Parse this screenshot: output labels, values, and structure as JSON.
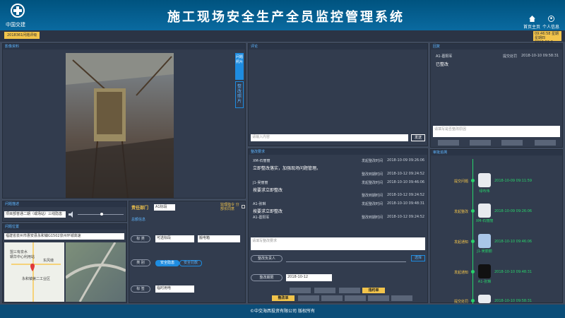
{
  "header": {
    "logo_text": "中国交建",
    "title": "施工现场安全生产全员监控管理系统",
    "home_label": "首页主页",
    "user_label": "个人信息"
  },
  "subbar": {
    "tag": "2018361问题评级",
    "date_line1": "09:46:58 星期星期四",
    "date_line2": "2018-02-6"
  },
  "left": {
    "photo_title": "影像资料",
    "tabs": [
      "问题照片",
      "整改照片"
    ],
    "problem_title": "问题描述",
    "problem_text": "项目部普通二期（或场站）三线隐患",
    "location_title": "问题位置",
    "location_text": "福建省泉州市惠安县永和镇G1502泉州环城高速",
    "map_labels": [
      "盟三有泉水",
      "辋华中心利用站",
      "东风墩",
      "永和镇第二工业区"
    ]
  },
  "middle": {
    "resp_label": "责任部门",
    "resp_value": "A1标段",
    "warn_text": "监理指令 分部长同意",
    "level_title": "总额信息",
    "rows": [
      {
        "label": "标  类",
        "value1": "可选标段",
        "value2": "搬电箱"
      },
      {
        "label": "类  别",
        "pill1": "安全隐患",
        "pill2": "安全罚款"
      },
      {
        "label": "标  签",
        "value1": "临时用电"
      }
    ]
  },
  "comments": {
    "title": "评论",
    "input_placeholder": "请输入内容",
    "send_label": "发送"
  },
  "rectify": {
    "title": "整改要求",
    "items": [
      {
        "name": "XM-石丽丽",
        "action": "发起整改时间",
        "time": "2018-10-09 09:26:06",
        "msg": "立即整改落实，加强现场问题管理。",
        "extra": "整改到期时间",
        "extra_time": "2018-10-12 09:24:52"
      },
      {
        "name": "J1-吴丽丽",
        "action": "发起整改时间",
        "time": "2018-10-10 09:46:06",
        "msg": "按要求立即整改",
        "extra": "整改到期时间",
        "extra_time": "2018-10-12 09:24:52"
      },
      {
        "name": "A1-张琳",
        "action": "发起整改时间",
        "time": "2018-10-10 09:48:31",
        "msg": "按要求立即整改",
        "extra": "整改到期时间",
        "extra_time": "2018-10-12 09:24:52",
        "sub": "A1-葛阳军"
      }
    ],
    "input_placeholder": "请填写整改要求",
    "person_label": "整改负责人",
    "choose_label": "选择",
    "deadline_label": "整改期限",
    "deadline_value": "2018-10-12",
    "btn_notice": "违约单",
    "btn_rectify": "整改单"
  },
  "reply": {
    "title": "回复",
    "name": "A1-葛阳军",
    "action": "提交处罚",
    "time": "2018-10-10 09:58:31",
    "msg": "已整改",
    "input_placeholder": "请填写是否整改原因"
  },
  "timeline": {
    "title": "审批追溯",
    "items": [
      {
        "label": "提交问题",
        "time": "2018-10-09 09:11:59",
        "name": "绿布伟"
      },
      {
        "label": "发起整改",
        "time": "2018-10-09 09:26:06",
        "name": "XM-石丽丽"
      },
      {
        "label": "发起通知",
        "time": "2018-10-10 09:46:06",
        "name": "J1-吴丽丽"
      },
      {
        "label": "发起通知",
        "time": "2018-10-10 09:48:31",
        "name": "A1-张琳"
      },
      {
        "label": "提交处罚",
        "time": "2018-10-10 09:58:31",
        "name": ""
      }
    ]
  },
  "footer": {
    "text": "©中交海西投资有限公司 版权所有"
  }
}
